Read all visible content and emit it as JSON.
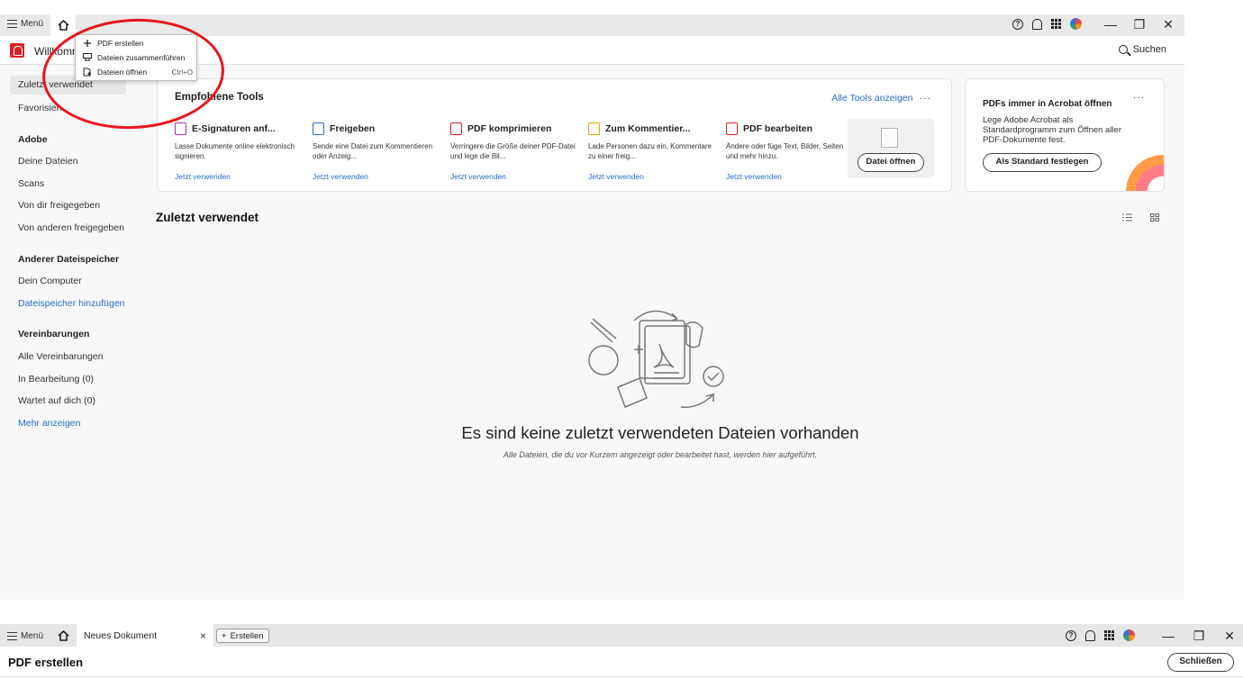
{
  "window_top": {
    "menu_label": "Menü",
    "header_title": "Willkomm",
    "search_label": "Suchen",
    "window_controls": {
      "minimize": "—",
      "maximize": "❐",
      "close": "✕"
    },
    "dropdown": {
      "items": [
        {
          "label": "PDF erstellen",
          "shortcut": "",
          "icon": "plus-icon"
        },
        {
          "label": "Dateien zusammenführen",
          "shortcut": "",
          "icon": "merge-icon"
        },
        {
          "label": "Dateien öffnen",
          "shortcut": "Ctrl+O",
          "icon": "open-file-icon"
        }
      ]
    },
    "sidebar": {
      "top_items": [
        "Zuletzt verwendet",
        "Favorisien"
      ],
      "sections": [
        {
          "heading": "Adobe",
          "items": [
            "Deine Dateien",
            "Scans",
            "Von dir freigegeben",
            "Von anderen freigegeben"
          ]
        },
        {
          "heading": "Anderer Dateispeicher",
          "items": [
            "Dein Computer"
          ],
          "link": "Dateispeicher hinzufügen"
        },
        {
          "heading": "Vereinbarungen",
          "items": [
            "Alle Vereinbarungen",
            "In Bearbeitung (0)",
            "Wartet auf dich (0)"
          ],
          "link": "Mehr anzeigen"
        }
      ]
    },
    "tools_card": {
      "title": "Empfohlene Tools",
      "all_tools_label": "Alle Tools anzeigen",
      "more": "···",
      "tools": [
        {
          "name": "E-Signaturen anf...",
          "desc": "Lasse Dokumente online elektronisch signieren.",
          "link": "Jetzt verwenden",
          "color": "#b02ab8"
        },
        {
          "name": "Freigeben",
          "desc": "Sende eine Datei zum Kommentieren oder Anzeig...",
          "link": "Jetzt verwenden",
          "color": "#2a6bd1"
        },
        {
          "name": "PDF komprimieren",
          "desc": "Verringere die Größe deiner PDF-Datei und lege die Bil...",
          "link": "Jetzt verwenden",
          "color": "#d7232a"
        },
        {
          "name": "Zum Kommentier...",
          "desc": "Lade Personen dazu ein, Kommentare zu einer freig...",
          "link": "Jetzt verwenden",
          "color": "#e7a500"
        },
        {
          "name": "PDF bearbeiten",
          "desc": "Ändere oder füge Text, Bilder, Seiten und mehr hinzu.",
          "link": "Jetzt verwenden",
          "color": "#d7232a"
        }
      ],
      "open_file_button": "Datei öffnen"
    },
    "promo_card": {
      "title": "PDFs immer in Acrobat öffnen",
      "text": "Lege Adobe Acrobat als Standardprogramm zum Öffnen aller PDF-Dokumente fest.",
      "button": "Als Standard festlegen",
      "more": "···"
    },
    "recent": {
      "title": "Zuletzt verwendet",
      "empty_title": "Es sind keine zuletzt verwendeten Dateien vorhanden",
      "empty_subtitle": "Alle Dateien, die du vor Kurzem angezeigt oder bearbeitet hast, werden hier aufgeführt."
    }
  },
  "window_bottom": {
    "menu_label": "Menü",
    "tab_label": "Neues Dokument",
    "tab_close": "×",
    "create_label": "Erstellen",
    "page_title": "PDF erstellen",
    "close_button": "Schließen",
    "window_controls": {
      "minimize": "—",
      "maximize": "❐",
      "close": "✕"
    }
  },
  "colors": {
    "accent_link": "#2a6bd1",
    "annotation_red": "#e8161b",
    "adobe_red": "#d7232a"
  }
}
